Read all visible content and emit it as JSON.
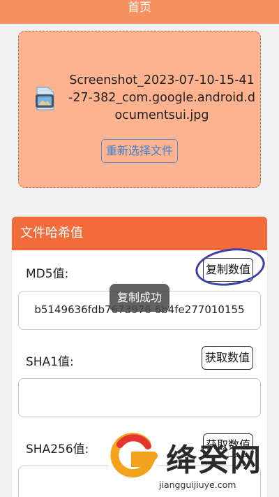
{
  "header": {
    "title": "首页"
  },
  "file": {
    "name": "Screenshot_2023-07-10-15-41-27-382_com.google.android.documentsui.jpg",
    "reselect_label": "重新选择文件"
  },
  "hash_panel": {
    "title": "文件哈希值",
    "md5": {
      "label": "MD5值:",
      "button": "复制数值",
      "value": "b5149636fdb7673976 6b4fe277010155"
    },
    "sha1": {
      "label": "SHA1值:",
      "button": "获取数值",
      "value": ""
    },
    "sha256": {
      "label": "SHA256值:",
      "button": "获取数值",
      "value": ""
    }
  },
  "toast": {
    "text": "复制成功"
  },
  "watermark": {
    "title": "绛癸网",
    "url": "jiangguijiuye.com"
  },
  "colors": {
    "topbar": "#f6915f",
    "file_card": "#fdb38f",
    "panel_header": "#f26b3a",
    "accent_link": "#3d81cf"
  }
}
